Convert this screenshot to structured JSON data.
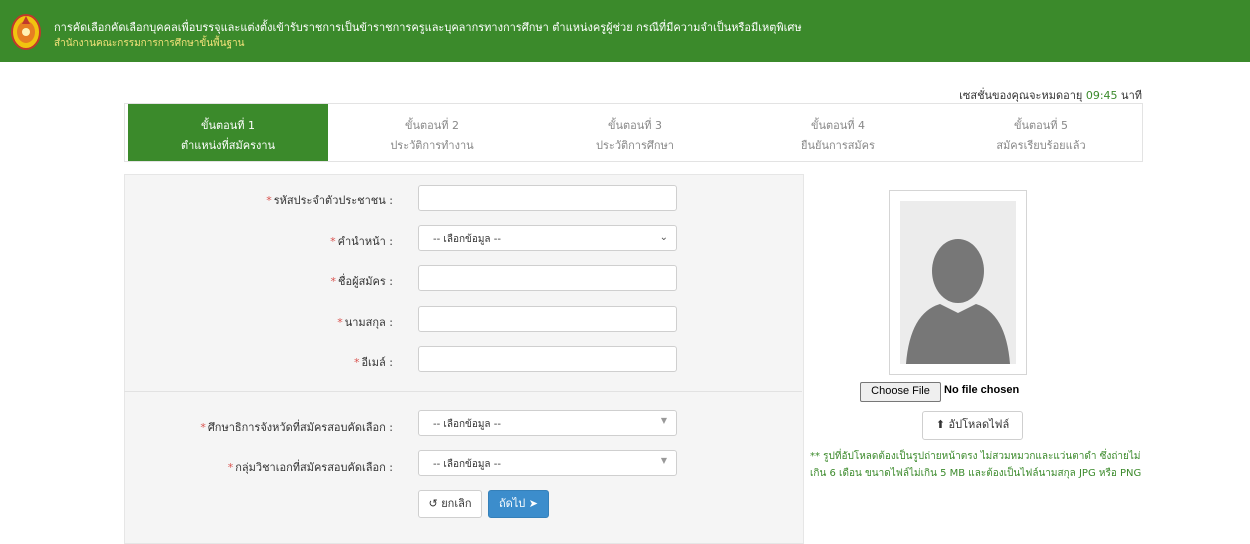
{
  "header": {
    "title": "การคัดเลือกคัดเลือกบุคคลเพื่อบรรจุและแต่งตั้งเข้ารับราชการเป็นข้าราชการครูและบุคลากรทางการศึกษา ตำแหน่งครูผู้ช่วย กรณีที่มีความจำเป็นหรือมีเหตุพิเศษ",
    "subtitle": "สำนักงานคณะกรรมการการศึกษาขั้นพื้นฐาน"
  },
  "session": {
    "label": "เซสชั่นของคุณจะหมดอายุ",
    "time": "09:45",
    "unit": "นาที"
  },
  "steps": [
    {
      "step": "ขั้นตอนที่ 1",
      "name": "ตำแหน่งที่สมัครงาน"
    },
    {
      "step": "ขั้นตอนที่ 2",
      "name": "ประวัติการทำงาน"
    },
    {
      "step": "ขั้นตอนที่ 3",
      "name": "ประวัติการศึกษา"
    },
    {
      "step": "ขั้นตอนที่ 4",
      "name": "ยืนยันการสมัคร"
    },
    {
      "step": "ขั้นตอนที่ 5",
      "name": "สมัครเรียบร้อยแล้ว"
    }
  ],
  "form": {
    "required_mark": "*",
    "citizen_id_label": "รหัสประจำตัวประชาชน :",
    "prefix_label": "คำนำหน้า :",
    "prefix_value": "-- เลือกข้อมูล --",
    "first_name_label": "ชื่อผู้สมัคร :",
    "last_name_label": "นามสกุล :",
    "email_label": "อีเมล์ :",
    "province_label": "ศึกษาธิการจังหวัดที่สมัครสอบคัดเลือก :",
    "province_value": "-- เลือกข้อมูล --",
    "subject_label": "กลุ่มวิชาเอกที่สมัครสอบคัดเลือก :",
    "subject_value": "-- เลือกข้อมูล --",
    "cancel_label": "ยกเลิก",
    "next_label": "ถัดไป"
  },
  "upload": {
    "choose_label": "Choose File",
    "no_file": "No file chosen",
    "upload_label": "อัปโหลดไฟล์",
    "note": "** รูปที่อัปโหลดต้องเป็นรูปถ่ายหน้าตรง ไม่สวมหมวกและแว่นตาดำ ซึ่งถ่ายไม่เกิน 6 เดือน ขนาดไฟล์ไม่เกิน 5 MB และต้องเป็นไฟล์นามสกุล JPG หรือ PNG"
  },
  "colors": {
    "header_bg": "#3b8a2b",
    "active_step": "#3b8a2b",
    "next_button": "#3c8dcc",
    "required": "#d9534f"
  }
}
